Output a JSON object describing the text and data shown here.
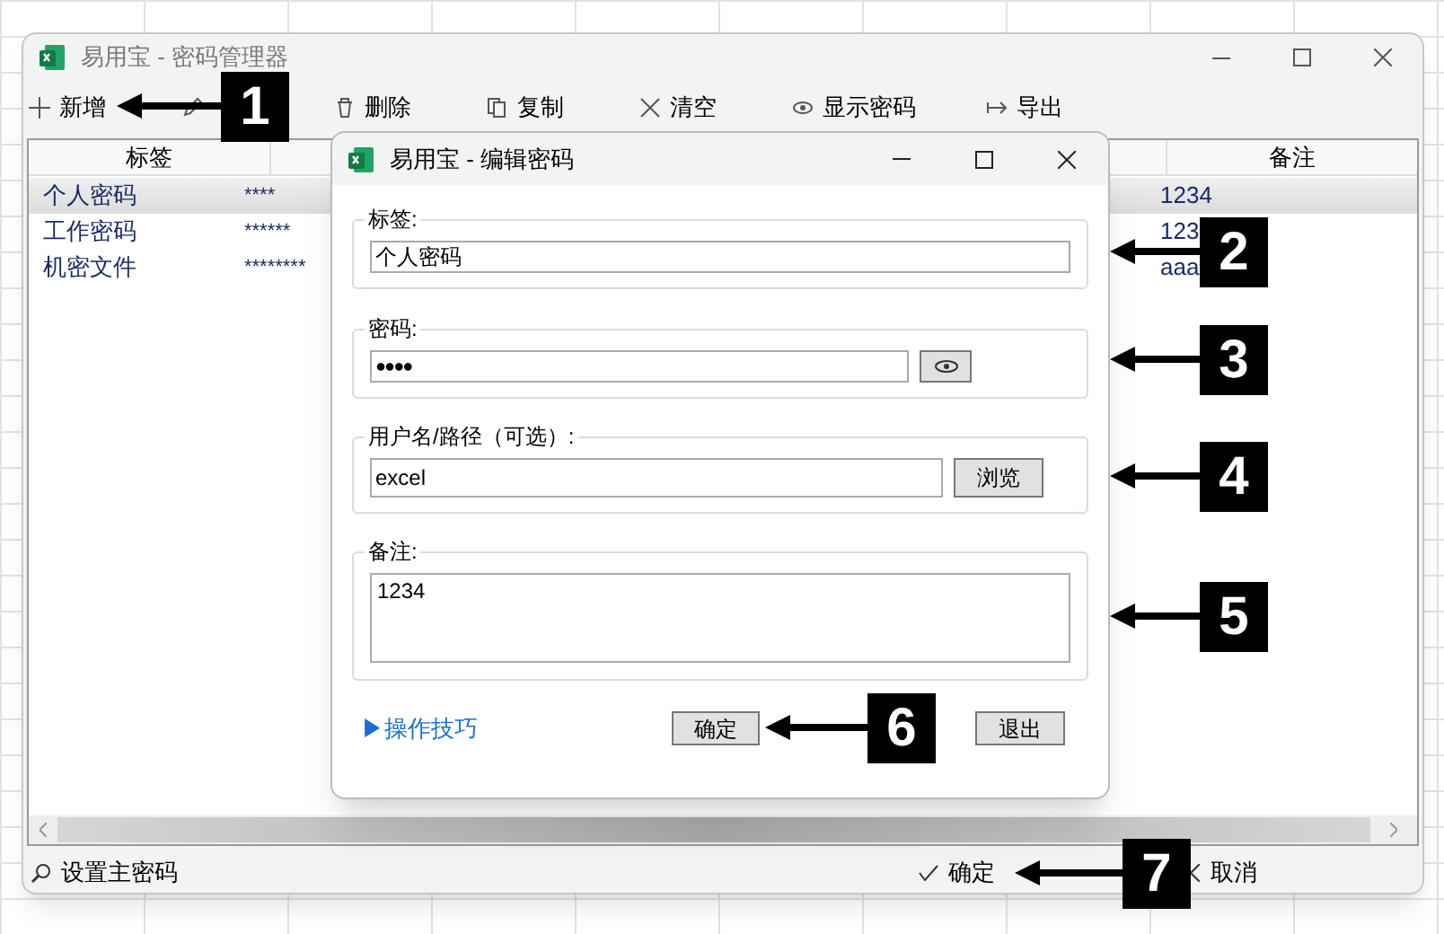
{
  "window": {
    "title": "易用宝 - 密码管理器"
  },
  "toolbar": [
    {
      "kind": "add",
      "label": "新增"
    },
    {
      "kind": "edit"
    },
    {
      "kind": "delete",
      "label": "删除"
    },
    {
      "kind": "copy",
      "label": "复制"
    },
    {
      "kind": "clear",
      "label": "清空"
    },
    {
      "kind": "show",
      "label": "显示密码"
    },
    {
      "kind": "export",
      "label": "导出"
    }
  ],
  "table": {
    "columns": [
      "标签",
      "备注"
    ],
    "rows": [
      {
        "label": "个人密码",
        "password": "****",
        "note": "1234",
        "selected": true
      },
      {
        "label": "工作密码",
        "password": "******",
        "note": "123",
        "selected": false
      },
      {
        "label": "机密文件",
        "password": "********",
        "note": "aaa",
        "selected": false
      }
    ]
  },
  "status_bar": {
    "master": "设置主密码",
    "ok": "确定",
    "cancel": "取消"
  },
  "dialog": {
    "title": "易用宝 - 编辑密码",
    "groups": [
      {
        "kind": "text",
        "legend": "标签:",
        "value": "个人密码"
      },
      {
        "kind": "password",
        "legend": "密码:",
        "value": "●●●●"
      },
      {
        "kind": "browse",
        "legend": "用户名/路径（可选）:",
        "value": "excel",
        "button": "浏览"
      },
      {
        "kind": "memo",
        "legend": "备注:",
        "value": "1234"
      }
    ],
    "tips": "▶操作技巧",
    "ok": "确定",
    "exit": "退出"
  },
  "callouts": [
    {
      "number": "1"
    },
    {
      "number": "2"
    },
    {
      "number": "3"
    },
    {
      "number": "4"
    },
    {
      "number": "5"
    },
    {
      "number": "6"
    },
    {
      "number": "7"
    }
  ]
}
